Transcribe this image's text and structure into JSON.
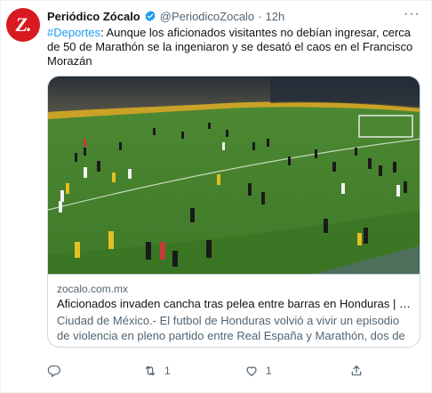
{
  "tweet": {
    "avatar_mark": "Z.",
    "display_name": "Periódico Zócalo",
    "handle": "@PeriodicoZocalo",
    "separator": "·",
    "time": "12h",
    "hashtag": "#Deportes",
    "body": ": Aunque los aficionados visitantes no debían ingresar, cerca de 50 de Marathón se la ingeniaron y se desató el caos en el Francisco Morazán",
    "more_icon": "ellipsis-icon"
  },
  "card": {
    "domain": "zocalo.com.mx",
    "title": "Aficionados invaden cancha tras pelea entre barras en Honduras | Periódico Zócalo",
    "description": "Ciudad de México.- El futbol de Honduras volvió a vivir un episodio de violencia en pleno partido entre Real España y Marathón, dos de los..."
  },
  "actions": {
    "reply": {
      "icon": "reply-icon",
      "count": ""
    },
    "retweet": {
      "icon": "retweet-icon",
      "count": "1"
    },
    "like": {
      "icon": "like-icon",
      "count": "1"
    },
    "share": {
      "icon": "share-icon",
      "count": ""
    }
  },
  "colors": {
    "accent": "#1d9bf0",
    "brand": "#d71920",
    "muted": "#536471"
  }
}
